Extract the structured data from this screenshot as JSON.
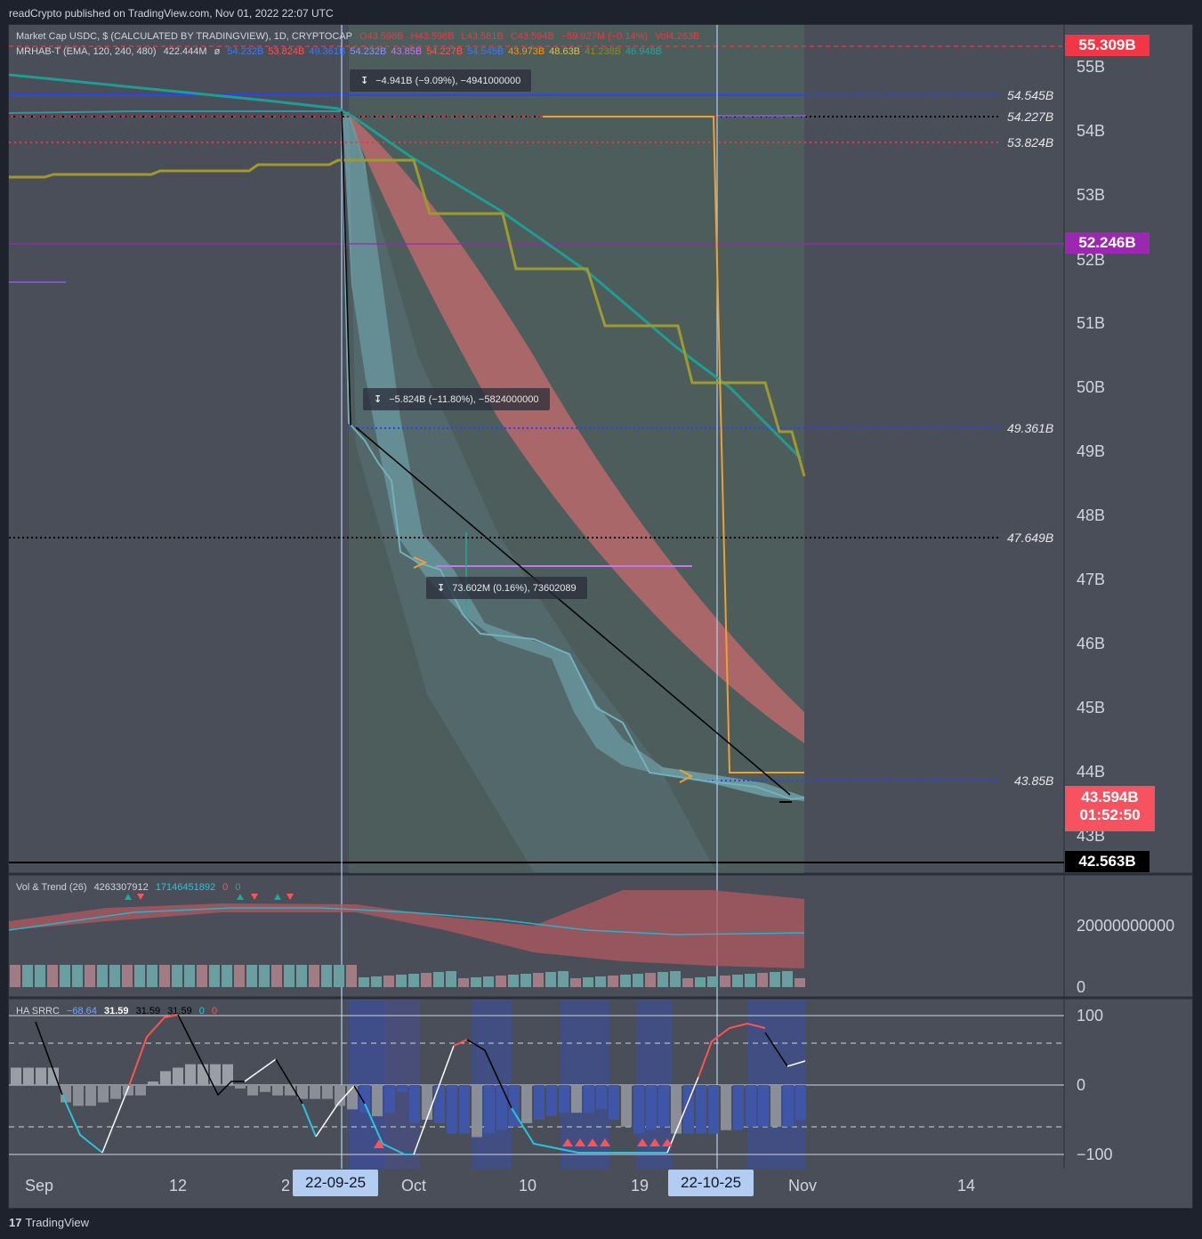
{
  "header": {
    "published": "readCrypto published on TradingView.com, Nov 01, 2022 22:07 UTC"
  },
  "legend": {
    "line1": {
      "title": "Market Cap USDC, $ (CALCULATED BY TRADINGVIEW), 1D, CRYPTOCAP",
      "o": "O43.598B",
      "h": "H43.598B",
      "l": "L43.581B",
      "c": "C43.594B",
      "chg": "−59.927M (−0.14%)",
      "vol": "Vol4.263B"
    },
    "line2": {
      "title": "MRHAB-T (EMA, 120, 240, 480)",
      "v1": "422.444M",
      "v2": "ø",
      "vals": [
        {
          "t": "54.232B",
          "c": "#3a79f5"
        },
        {
          "t": "53.824B",
          "c": "#ff5252"
        },
        {
          "t": "49.361B",
          "c": "#3a79f5"
        },
        {
          "t": "54.232B",
          "c": "#8e91f5"
        },
        {
          "t": "43.85B",
          "c": "#c478ee"
        },
        {
          "t": "54.227B",
          "c": "#ff5252"
        },
        {
          "t": "54.545B",
          "c": "#3a79f5"
        },
        {
          "t": "43.973B",
          "c": "#ff9800"
        },
        {
          "t": "48.63B",
          "c": "#d6c44c"
        },
        {
          "t": "41.238B",
          "c": "#8a8a24"
        },
        {
          "t": "46.948B",
          "c": "#26a69a"
        }
      ]
    }
  },
  "price_axis": {
    "labels": [
      "55B",
      "54B",
      "53B",
      "52B",
      "51B",
      "50B",
      "49B",
      "48B",
      "47B",
      "46B",
      "45B",
      "44B",
      "43B"
    ],
    "tags": {
      "red_top": "55.309B",
      "purple": "52.246B",
      "current": "43.594B",
      "countdown": "01:52:50",
      "low": "42.563B"
    },
    "colors": {
      "red": "#f23645",
      "purple": "#9c27b0",
      "current": "#f7525f",
      "low": "#000000"
    }
  },
  "hlines": {
    "l54545": "54.545B",
    "l54227": "54.227B",
    "l53824": "53.824B",
    "l49361": "49.361B",
    "l47649": "47.649B",
    "l4385": "43.85B"
  },
  "measures": {
    "m1": "−4.941B (−9.09%), −4941000000",
    "m2": "−5.824B (−11.80%), −5824000000",
    "m3": "73.602M (0.16%), 73602089",
    "icon": "↧"
  },
  "volpanel": {
    "title": "Vol & Trend (26)",
    "v1": "4263307912",
    "v2": "17146451892",
    "v3": "0",
    "v4": "0",
    "axis_top": "20000000000",
    "axis_bottom": "0"
  },
  "hapanel": {
    "title": "HA SRRC",
    "v1": "−68.64",
    "v2": "31.59",
    "v3": "31.59",
    "v4": "31.59",
    "v5": "0",
    "v6": "0",
    "axis": [
      "100",
      "0",
      "−100"
    ]
  },
  "xaxis": {
    "labels": [
      "Sep",
      "12",
      "2",
      "Oct",
      "10",
      "19",
      "Nov",
      "14"
    ],
    "pill1": "22-09-25",
    "pill2": "22-10-25"
  },
  "footer": {
    "brand": "TradingView"
  },
  "chart_data": {
    "type": "line",
    "series": [
      {
        "name": "Market Cap USDC",
        "x": [
          "2022-09-01",
          "2022-09-12",
          "2022-09-24",
          "2022-09-25",
          "2022-09-28",
          "2022-10-01",
          "2022-10-05",
          "2022-10-08",
          "2022-10-12",
          "2022-10-15",
          "2022-10-19",
          "2022-10-22",
          "2022-10-25",
          "2022-10-29",
          "2022-11-01"
        ],
        "y": [
          54.2,
          54.25,
          54.23,
          49.36,
          48.6,
          47.3,
          46.9,
          46.2,
          45.9,
          45.0,
          44.4,
          44.0,
          43.85,
          43.7,
          43.59
        ]
      }
    ],
    "ylim": [
      42.5,
      55.5
    ]
  }
}
